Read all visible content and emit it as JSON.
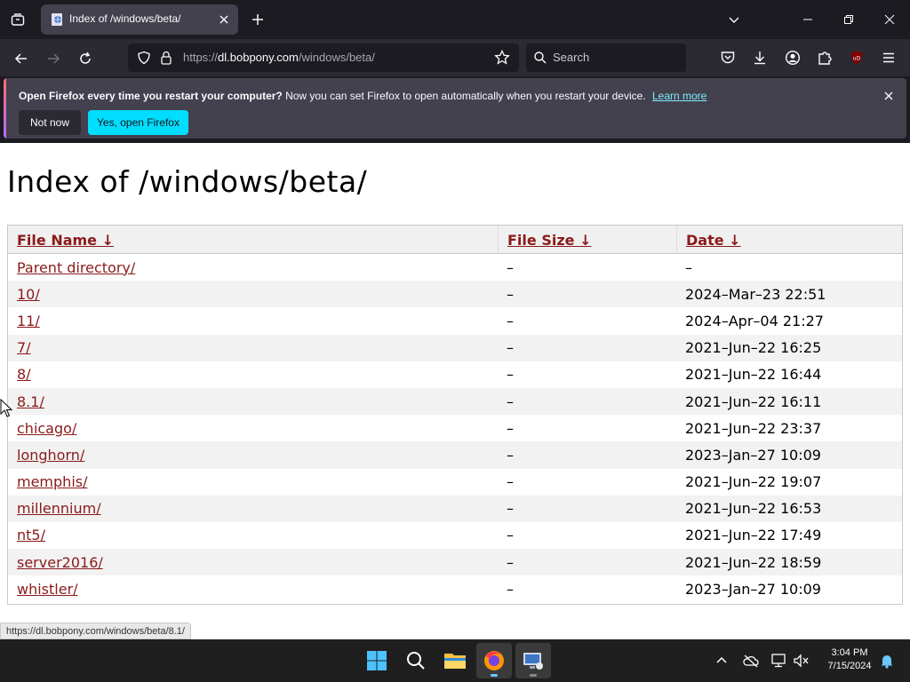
{
  "browser": {
    "tab": {
      "title": "Index of /windows/beta/"
    },
    "url": {
      "prefix": "https://",
      "host": "dl.bobpony.com",
      "path": "/windows/beta/"
    },
    "search_placeholder": "Search"
  },
  "notification": {
    "bold": "Open Firefox every time you restart your computer?",
    "text": "Now you can set Firefox to open automatically when you restart your device.",
    "learn_more": "Learn more",
    "not_now": "Not now",
    "yes": "Yes, open Firefox"
  },
  "page": {
    "title": "Index of /windows/beta/",
    "columns": [
      "File Name  ↓",
      "File Size  ↓",
      "Date  ↓"
    ],
    "rows": [
      {
        "name": "Parent directory/",
        "size": "–",
        "date": "–"
      },
      {
        "name": "10/",
        "size": "–",
        "date": "2024–Mar–23 22:51"
      },
      {
        "name": "11/",
        "size": "–",
        "date": "2024–Apr–04 21:27"
      },
      {
        "name": "7/",
        "size": "–",
        "date": "2021–Jun–22 16:25"
      },
      {
        "name": "8/",
        "size": "–",
        "date": "2021–Jun–22 16:44"
      },
      {
        "name": "8.1/",
        "size": "–",
        "date": "2021–Jun–22 16:11"
      },
      {
        "name": "chicago/",
        "size": "–",
        "date": "2021–Jun–22 23:37"
      },
      {
        "name": "longhorn/",
        "size": "–",
        "date": "2023–Jan–27 10:09"
      },
      {
        "name": "memphis/",
        "size": "–",
        "date": "2021–Jun–22 19:07"
      },
      {
        "name": "millennium/",
        "size": "–",
        "date": "2021–Jun–22 16:53"
      },
      {
        "name": "nt5/",
        "size": "–",
        "date": "2021–Jun–22 17:49"
      },
      {
        "name": "server2016/",
        "size": "–",
        "date": "2021–Jun–22 18:59"
      },
      {
        "name": "whistler/",
        "size": "–",
        "date": "2023–Jan–27 10:09"
      }
    ],
    "status_url": "https://dl.bobpony.com/windows/beta/8.1/"
  },
  "taskbar": {
    "time": "3:04 PM",
    "date": "7/15/2024"
  },
  "colors": {
    "link": "#8b1a1a",
    "accent": "#00ddff"
  }
}
